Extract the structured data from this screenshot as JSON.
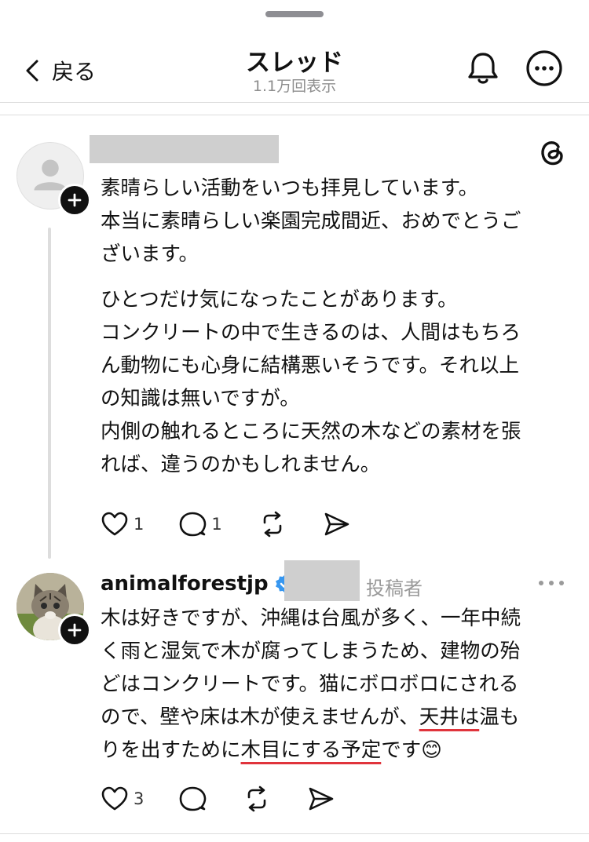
{
  "header": {
    "back_label": "戻る",
    "title": "スレッド",
    "views": "1.1万回表示"
  },
  "comment1": {
    "lines": [
      "素晴らしい活動をいつも拝見しています。",
      "本当に素晴らしい楽園完成間近、おめでとうご",
      "ざいます。",
      "ひとつだけ気になったことがあります。",
      "コンクリートの中で生きるのは、人間はもちろ",
      "ん動物にも心身に結構悪いそうです。それ以上",
      "の知識は無いですが。",
      "内側の触れるところに天然の木などの素材を張",
      "れば、違うのかもしれません。"
    ],
    "likes": "1",
    "replies": "1"
  },
  "reply": {
    "username": "animalforestjp",
    "author_tag": "投稿者",
    "line1": "木は好きですが、沖縄は台風が多く、一年中続",
    "line2": "く雨と湿気で木が腐ってしまうため、建物の殆",
    "line3": "どはコンクリートです。猫にボロボロにされる",
    "line4_a": "ので、壁や床は木が使えませんが、",
    "line4_b": "天井は",
    "line4_c": "温も",
    "line5_a": "りを出すために",
    "line5_b": "木目にする予定",
    "line5_c": "です",
    "emoji": "😊",
    "likes": "3"
  },
  "colors": {
    "verified_blue": "#3797f0",
    "annotation_red": "#e0343c"
  },
  "icons": [
    "chevron-left-icon",
    "bell-icon",
    "more-icon",
    "threads-logo-icon",
    "plus-icon",
    "verified-icon",
    "heart-icon",
    "comment-icon",
    "repost-icon",
    "share-icon"
  ]
}
